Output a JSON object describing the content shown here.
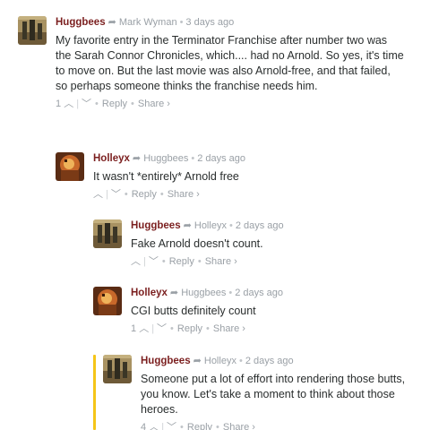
{
  "colors": {
    "author": "#7b1f1f",
    "meta": "#9aa0a6",
    "text": "#2a2e2e",
    "highlight": "#f5c518"
  },
  "comments": [
    {
      "author": "Huggbees",
      "parent": "Mark Wyman",
      "time": "3 days ago",
      "text": "My favorite entry in the Terminator Franchise after number two was the Sarah Connor Chronicles, which.... had no Arnold. So yes, it's time to move on. But the last movie was also Arnold-free, and that failed, so perhaps someone thinks the franchise needs him.",
      "upvotes": "1",
      "reply": "Reply",
      "share": "Share ›"
    },
    {
      "author": "Holleyx",
      "parent": "Huggbees",
      "time": "2 days ago",
      "text": "It wasn't *entirely* Arnold free",
      "upvotes": "",
      "reply": "Reply",
      "share": "Share ›"
    },
    {
      "author": "Huggbees",
      "parent": "Holleyx",
      "time": "2 days ago",
      "text": "Fake Arnold doesn't count.",
      "upvotes": "",
      "reply": "Reply",
      "share": "Share ›"
    },
    {
      "author": "Holleyx",
      "parent": "Huggbees",
      "time": "2 days ago",
      "text": "CGI butts definitely count",
      "upvotes": "1",
      "reply": "Reply",
      "share": "Share ›"
    },
    {
      "author": "Huggbees",
      "parent": "Holleyx",
      "time": "2 days ago",
      "text": "Someone put a lot of effort into rendering those butts, you know. Let's take a moment to think about those heroes.",
      "upvotes": "4",
      "reply": "Reply",
      "share": "Share ›"
    }
  ]
}
